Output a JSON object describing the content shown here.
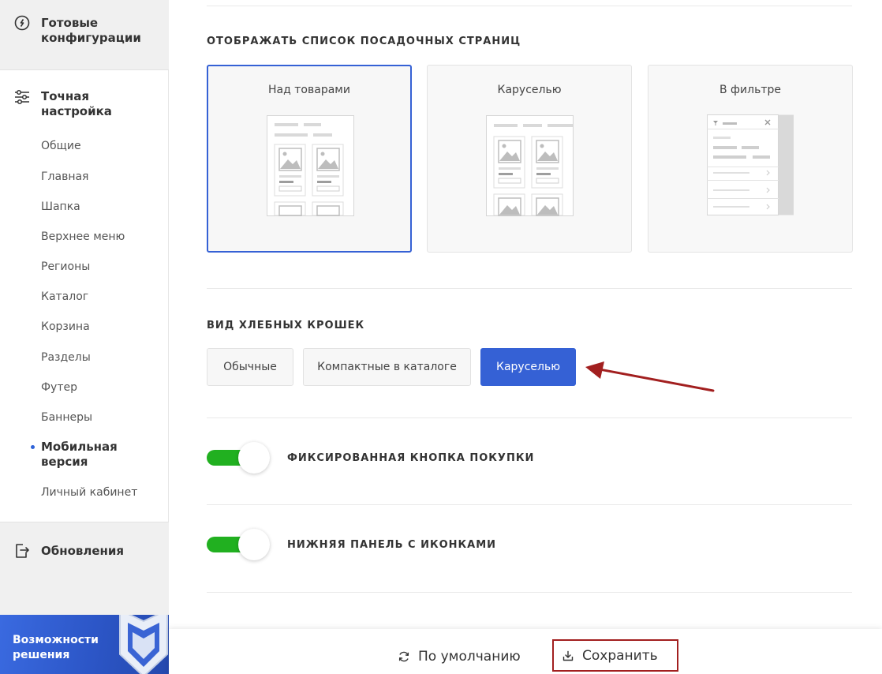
{
  "sidebar": {
    "ready_configs": "Готовые конфигурации",
    "fine_tuning": "Точная настройка",
    "items": [
      {
        "label": "Общие"
      },
      {
        "label": "Главная"
      },
      {
        "label": "Шапка"
      },
      {
        "label": "Верхнее меню"
      },
      {
        "label": "Регионы"
      },
      {
        "label": "Каталог"
      },
      {
        "label": "Корзина"
      },
      {
        "label": "Разделы"
      },
      {
        "label": "Футер"
      },
      {
        "label": "Баннеры"
      },
      {
        "label": "Мобильная версия",
        "active": true
      },
      {
        "label": "Личный кабинет"
      }
    ],
    "updates": "Обновления",
    "promo": "Возможности решения"
  },
  "landing": {
    "title": "ОТОБРАЖАТЬ СПИСОК ПОСАДОЧНЫХ СТРАНИЦ",
    "options": [
      {
        "label": "Над товарами",
        "selected": true
      },
      {
        "label": "Каруселью",
        "selected": false
      },
      {
        "label": "В фильтре",
        "selected": false
      }
    ]
  },
  "breadcrumbs": {
    "title": "ВИД ХЛЕБНЫХ КРОШЕК",
    "options": [
      {
        "label": "Обычные",
        "selected": false
      },
      {
        "label": "Компактные в каталоге",
        "selected": false
      },
      {
        "label": "Каруселью",
        "selected": true
      }
    ]
  },
  "toggles": [
    {
      "label": "ФИКСИРОВАННАЯ КНОПКА ПОКУПКИ",
      "on": true
    },
    {
      "label": "НИЖНЯЯ ПАНЕЛЬ С ИКОНКАМИ",
      "on": true
    }
  ],
  "footer": {
    "default_label": "По умолчанию",
    "save_label": "Сохранить"
  },
  "colors": {
    "accent": "#3561d5",
    "toggle_on": "#21b020",
    "annotation": "#a21f1f"
  }
}
